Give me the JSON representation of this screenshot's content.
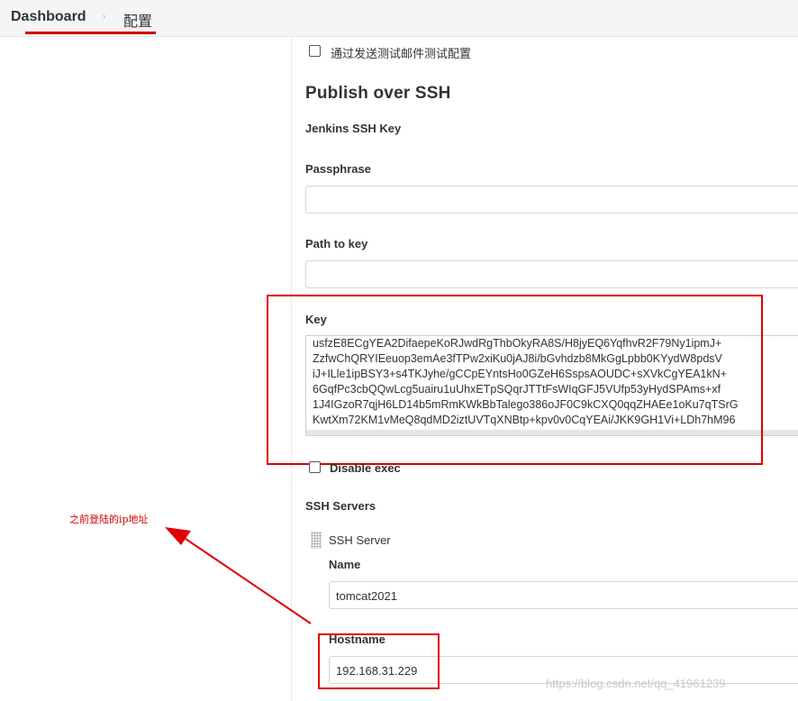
{
  "breadcrumb": {
    "dashboard": "Dashboard",
    "separator": "›",
    "current": "配置"
  },
  "options": {
    "test_mail_label": "通过发送测试邮件测试配置",
    "disable_exec_label": "Disable exec"
  },
  "section": {
    "title": "Publish over SSH",
    "jenkins_ssh_key": "Jenkins SSH Key",
    "passphrase_label": "Passphrase",
    "passphrase_value": "",
    "path_to_key_label": "Path to key",
    "path_to_key_value": "",
    "key_label": "Key",
    "key_lines": [
      "usfzE8ECgYEA2DifaepeKoRJwdRgThbOkyRA8S/H8jyEQ6YqfhvR2F79Ny1ipmJ+",
      "ZzfwChQRYIEeuop3emAe3fTPw2xiKu0jAJ8i/bGvhdzb8MkGgLpbb0KYydW8pdsV",
      "iJ+ILle1ipBSY3+s4TKJyhe/gCCpEYntsHo0GZeH6SspsAOUDC+sXVkCgYEA1kN+",
      "6GqfPc3cbQQwLcg5uairu1uUhxETpSQqrJTTtFsWIqGFJ5VUfp53yHydSPAms+xf",
      "1J4IGzoR7qjH6LD14b5mRmKWkBbTalego386oJF0C9kCXQ0qqZHAEe1oKu7qTSrG",
      "KwtXm72KM1vMeQ8qdMD2iztUVTqXNBtp+kpv0v0CqYEAi/JKK9GH1Vi+LDh7hM96"
    ]
  },
  "ssh_servers": {
    "title": "SSH Servers",
    "server_heading": "SSH Server",
    "name_label": "Name",
    "name_value": "tomcat2021",
    "hostname_label": "Hostname",
    "hostname_value": "192.168.31.229"
  },
  "annotation": {
    "text": "之前登陆的ip地址",
    "color": "#e00000"
  },
  "watermark": "https://blog.csdn.net/qq_41961239"
}
